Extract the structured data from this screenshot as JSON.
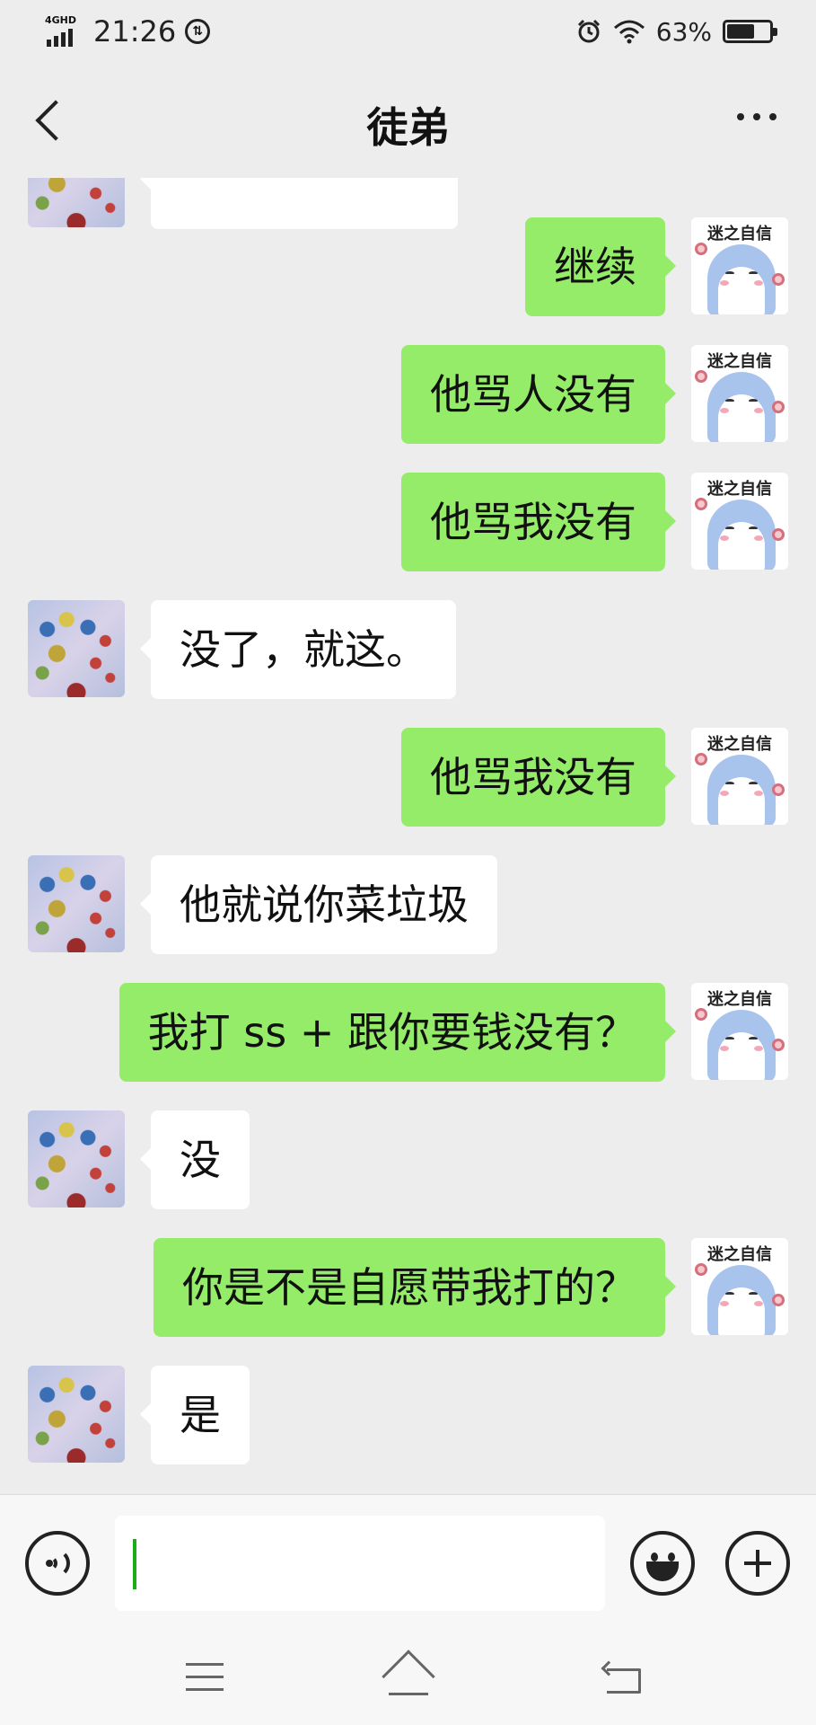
{
  "status_bar": {
    "network": "4GHD",
    "time": "21:26",
    "battery_percent": "63%",
    "battery_level": 0.63,
    "icons": [
      "signal-icon",
      "data-sync-icon",
      "alarm-icon",
      "wifi-icon",
      "battery-icon"
    ]
  },
  "header": {
    "title": "徒弟",
    "back_icon": "chevron-left-icon",
    "more_icon": "more-dots-icon"
  },
  "avatars": {
    "self_caption": "迷之自信"
  },
  "messages": [
    {
      "side": "left",
      "text": ""
    },
    {
      "side": "right",
      "text": "继续"
    },
    {
      "side": "right",
      "text": "他骂人没有"
    },
    {
      "side": "right",
      "text": "他骂我没有"
    },
    {
      "side": "left",
      "text": "没了，就这。"
    },
    {
      "side": "right",
      "text": "他骂我没有"
    },
    {
      "side": "left",
      "text": "他就说你菜垃圾"
    },
    {
      "side": "right",
      "text": "我打 ss + 跟你要钱没有？"
    },
    {
      "side": "left",
      "text": "没"
    },
    {
      "side": "right",
      "text": "你是不是自愿带我打的？"
    },
    {
      "side": "left",
      "text": "是"
    }
  ],
  "input_bar": {
    "text_value": "",
    "voice_icon": "voice-icon",
    "emoji_icon": "emoji-icon",
    "plus_icon": "plus-icon"
  },
  "nav_bar": {
    "icons": [
      "menu-icon",
      "home-icon",
      "back-icon"
    ]
  },
  "colors": {
    "background": "#ededed",
    "own_bubble": "#95ec69",
    "other_bubble": "#ffffff",
    "caret": "#1aad19"
  }
}
